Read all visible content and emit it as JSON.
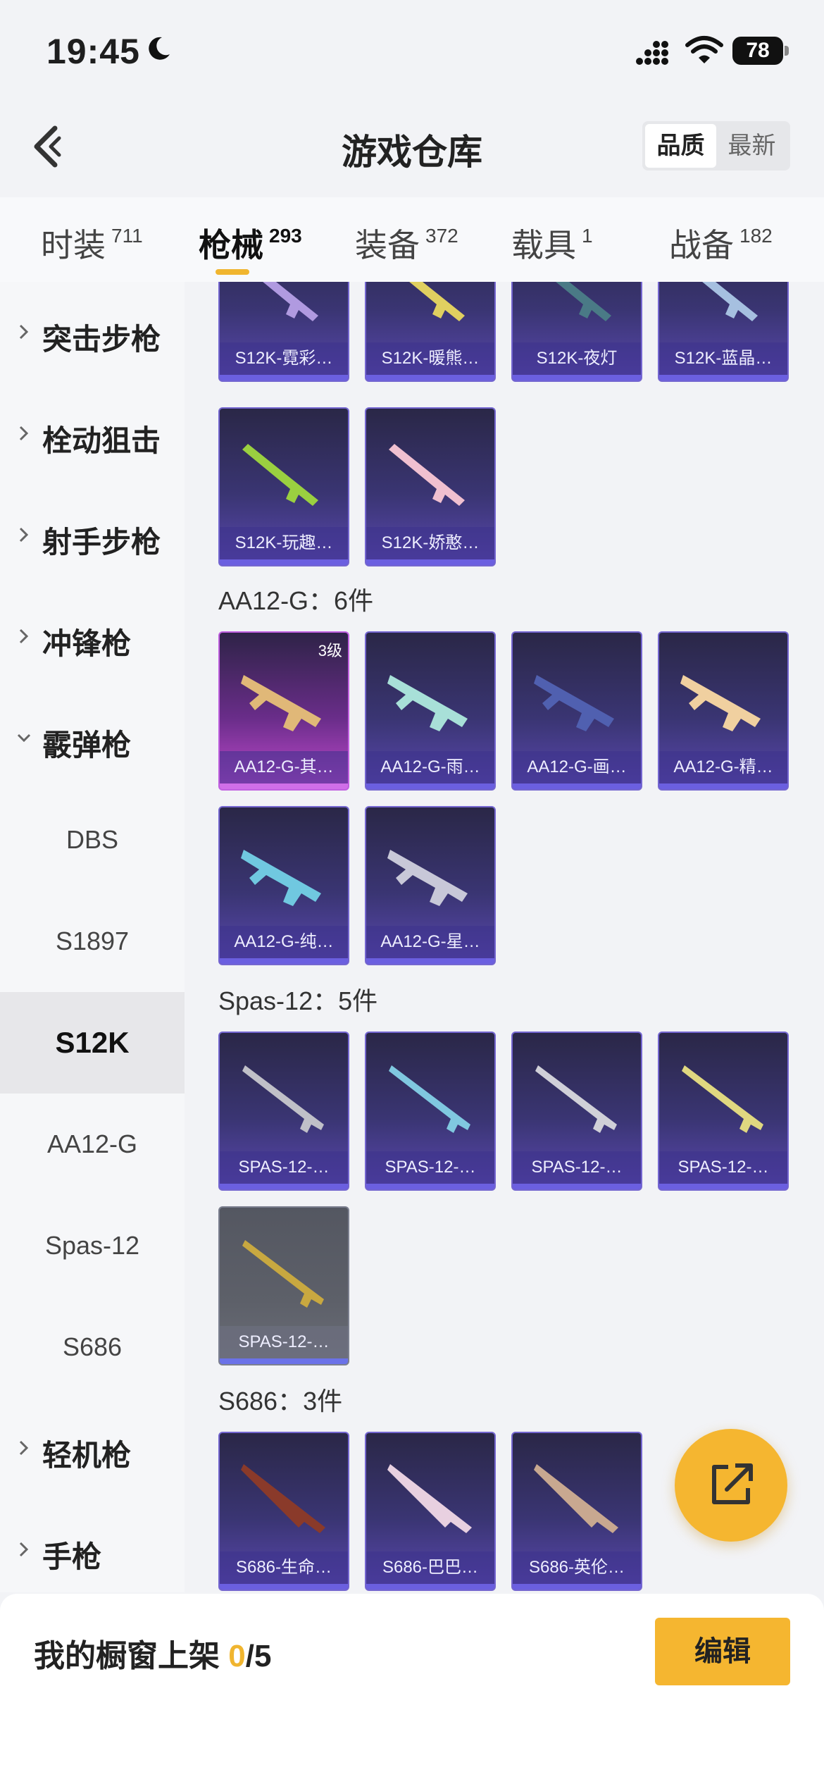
{
  "status_bar": {
    "time": "19:45",
    "battery": "78",
    "battery_level": 0.78
  },
  "header": {
    "title": "游戏仓库",
    "back_icon": "chevron-left-icon",
    "sort_options": [
      "品质",
      "最新"
    ],
    "sort_selected": "品质"
  },
  "tabs": [
    {
      "label": "时装",
      "count": "711"
    },
    {
      "label": "枪械",
      "count": "293",
      "active": true
    },
    {
      "label": "装备",
      "count": "372"
    },
    {
      "label": "载具",
      "count": "1"
    },
    {
      "label": "战备",
      "count": "182"
    }
  ],
  "sidebar": {
    "categories": [
      {
        "label": "突击步枪"
      },
      {
        "label": "栓动狙击"
      },
      {
        "label": "射手步枪"
      },
      {
        "label": "冲锋枪"
      },
      {
        "label": "霰弹枪",
        "expanded": true
      }
    ],
    "sub_items": [
      "DBS",
      "S1897",
      "S12K",
      "AA12-G",
      "Spas-12",
      "S686"
    ],
    "selected_sub": "S12K",
    "more_categories": [
      {
        "label": "轻机枪"
      },
      {
        "label": "手枪"
      }
    ]
  },
  "content": {
    "s12k_top_row": [
      "S12K-霓彩…",
      "S12K-暖熊…",
      "S12K-夜灯",
      "S12K-蓝晶…"
    ],
    "s12k_second_row": [
      "S12K-玩趣…",
      "S12K-娇憨…"
    ],
    "sections": [
      {
        "title": "AA12-G：6件",
        "items": [
          {
            "name": "AA12-G-其…",
            "level": "3级",
            "rarity": "pink"
          },
          {
            "name": "AA12-G-雨…"
          },
          {
            "name": "AA12-G-画…"
          },
          {
            "name": "AA12-G-精…"
          },
          {
            "name": "AA12-G-纯…"
          },
          {
            "name": "AA12-G-星…"
          }
        ]
      },
      {
        "title": "Spas-12：5件",
        "items": [
          {
            "name": "SPAS-12-…"
          },
          {
            "name": "SPAS-12-…"
          },
          {
            "name": "SPAS-12-…"
          },
          {
            "name": "SPAS-12-…"
          },
          {
            "name": "SPAS-12-…",
            "rarity": "gray"
          }
        ]
      },
      {
        "title": "S686：3件",
        "items": [
          {
            "name": "S686-生命…"
          },
          {
            "name": "S686-巴巴…"
          },
          {
            "name": "S686-英伦…"
          }
        ]
      }
    ]
  },
  "fab": {
    "icon": "share-external-icon"
  },
  "bottom": {
    "shelf_label": "我的橱窗上架 ",
    "shelf_count": "0",
    "shelf_total": "/5",
    "edit_label": "编辑"
  },
  "colors": {
    "accent": "#f5b630",
    "card_purple": "#3a3573",
    "card_pink": "#c44bd0"
  }
}
